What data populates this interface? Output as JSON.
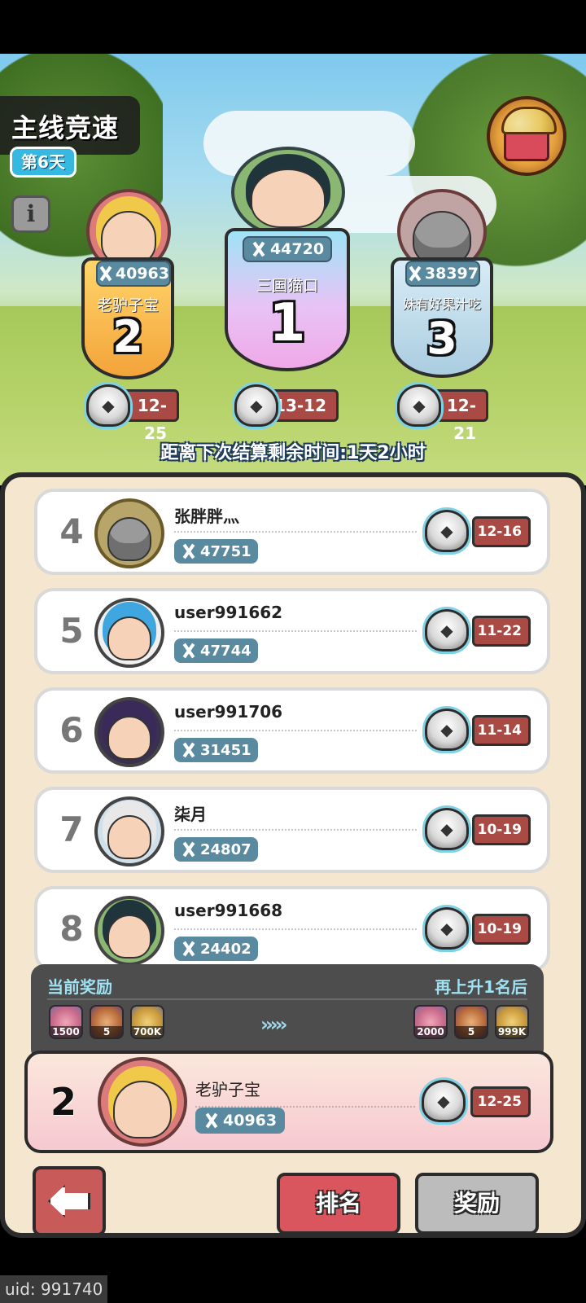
{
  "header": {
    "title": "主线竞速",
    "day_badge": "第6天",
    "info_icon": "info-icon",
    "gift_icon": "gift-box-icon"
  },
  "podium": [
    {
      "rank": "1",
      "name": "三国猫口",
      "score": "44720",
      "stage": "13-12"
    },
    {
      "rank": "2",
      "name": "老驴子宝",
      "score": "40963",
      "stage": "12-25"
    },
    {
      "rank": "3",
      "name": "妹有好果汁吃",
      "score": "38397",
      "stage": "12-21"
    }
  ],
  "countdown": "距离下次结算剩余时间:1天2小时",
  "rows": [
    {
      "rank": "4",
      "name": "张胖胖灬",
      "score": "47751",
      "stage": "12-16"
    },
    {
      "rank": "5",
      "name": "user991662",
      "score": "47744",
      "stage": "11-22"
    },
    {
      "rank": "6",
      "name": "user991706",
      "score": "31451",
      "stage": "11-14"
    },
    {
      "rank": "7",
      "name": "柒月",
      "score": "24807",
      "stage": "10-19"
    },
    {
      "rank": "8",
      "name": "user991668",
      "score": "24402",
      "stage": "10-19"
    }
  ],
  "rewards": {
    "current_label": "当前奖励",
    "next_label": "再上升1名后",
    "current": [
      {
        "icon": "gem-icon",
        "count": "1500"
      },
      {
        "icon": "card-icon",
        "count": "5"
      },
      {
        "icon": "coin-icon",
        "count": "700K"
      }
    ],
    "next": [
      {
        "icon": "gem-icon",
        "count": "2000"
      },
      {
        "icon": "card-icon",
        "count": "5"
      },
      {
        "icon": "coin-icon",
        "count": "999K"
      }
    ],
    "arrows": "›››››"
  },
  "me": {
    "rank": "2",
    "name": "老驴子宝",
    "score": "40963",
    "stage": "12-25"
  },
  "tabs": {
    "ranking": "排名",
    "rewards": "奖励"
  },
  "uid": "uid: 991740",
  "colors": {
    "accent_red": "#d9565e",
    "score_badge": "#5a8aa0",
    "stage_badge": "#a94a44",
    "panel": "#f5e7cf"
  }
}
